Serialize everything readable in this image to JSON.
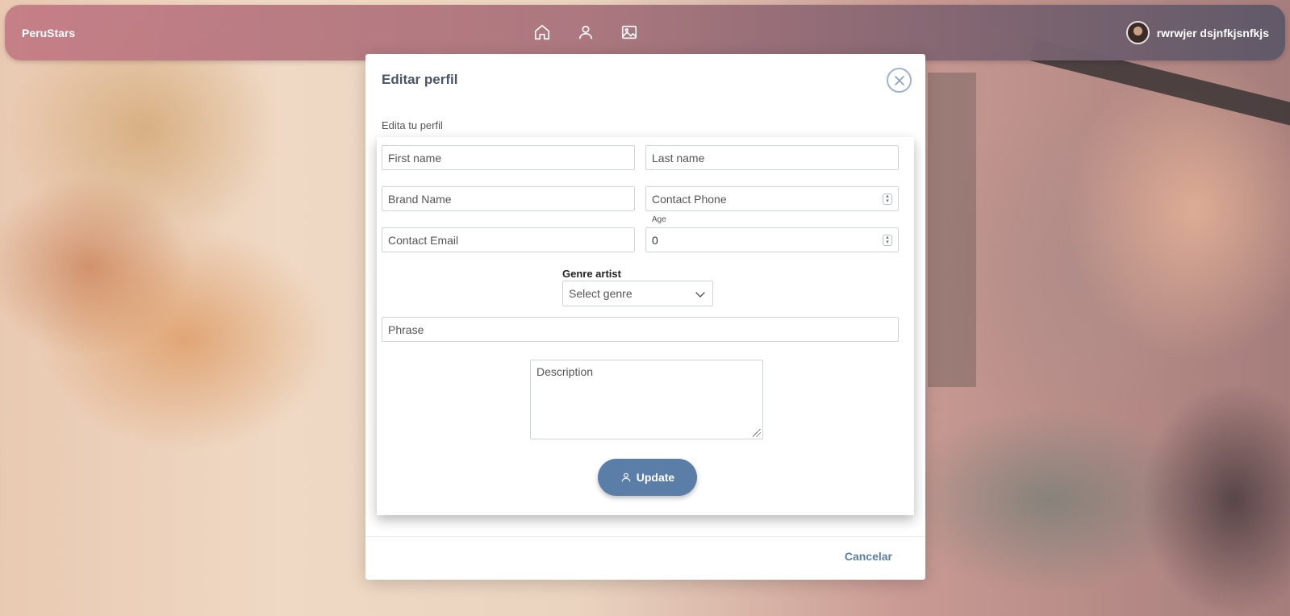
{
  "navbar": {
    "brand": "PeruStars",
    "icons": [
      "home-icon",
      "user-icon",
      "image-icon"
    ],
    "user_name": "rwrwjer dsjnfkjsnfkjs"
  },
  "modal": {
    "title": "Editar perfil",
    "subtitle": "Edita tu perfil",
    "cancel_label": "Cancelar"
  },
  "form": {
    "first_name_placeholder": "First name",
    "last_name_placeholder": "Last name",
    "brand_name_placeholder": "Brand Name",
    "contact_phone_placeholder": "Contact Phone",
    "age_label": "Age",
    "contact_email_placeholder": "Contact Email",
    "age_value": "0",
    "genre_label": "Genre artist",
    "genre_selected": "Select genre",
    "phrase_placeholder": "Phrase",
    "description_placeholder": "Description",
    "update_label": "Update"
  },
  "colors": {
    "accent": "#5b7ea8",
    "navbar_start": "#c47c85",
    "navbar_end": "#5e5868"
  }
}
